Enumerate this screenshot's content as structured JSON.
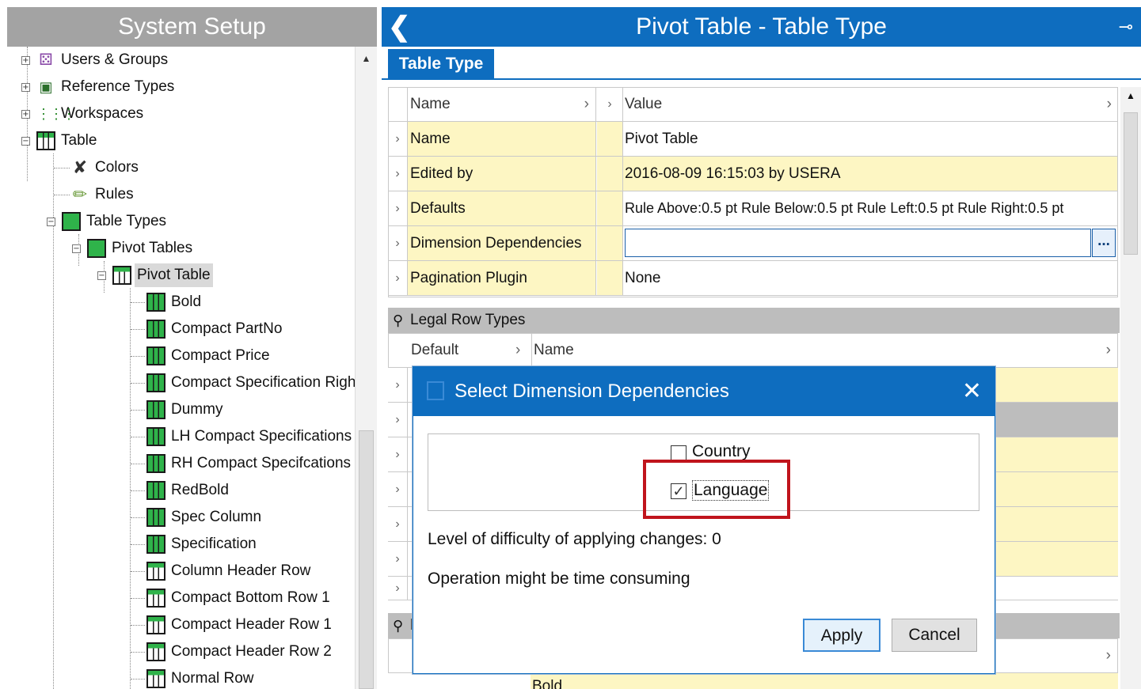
{
  "left_panel": {
    "title": "System Setup",
    "tree": [
      {
        "label": "Users & Groups",
        "icon": "users-icon"
      },
      {
        "label": "Reference Types",
        "icon": "reference-icon"
      },
      {
        "label": "Workspaces",
        "icon": "workspaces-icon"
      },
      {
        "label": "Table",
        "icon": "table-icon"
      },
      {
        "label": "Colors",
        "icon": "colors-icon"
      },
      {
        "label": "Rules",
        "icon": "rules-icon"
      },
      {
        "label": "Table Types",
        "icon": "table-types-icon"
      },
      {
        "label": "Pivot Tables",
        "icon": "pivot-tables-icon"
      },
      {
        "label": "Pivot Table",
        "icon": "pivot-table-icon",
        "selected": true
      },
      {
        "label": "Bold",
        "icon": "row-type-icon"
      },
      {
        "label": "Compact PartNo",
        "icon": "row-type-icon"
      },
      {
        "label": "Compact Price",
        "icon": "row-type-icon"
      },
      {
        "label": "Compact Specification Right",
        "icon": "row-type-icon"
      },
      {
        "label": "Dummy",
        "icon": "row-type-icon"
      },
      {
        "label": "LH Compact Specifications",
        "icon": "row-type-icon"
      },
      {
        "label": "RH Compact Specifcations",
        "icon": "row-type-icon"
      },
      {
        "label": "RedBold",
        "icon": "row-type-icon"
      },
      {
        "label": "Spec Column",
        "icon": "row-type-icon"
      },
      {
        "label": "Specification",
        "icon": "row-type-icon"
      },
      {
        "label": "Column Header Row",
        "icon": "header-row-icon"
      },
      {
        "label": "Compact Bottom Row 1",
        "icon": "header-row-icon"
      },
      {
        "label": "Compact Header Row 1",
        "icon": "header-row-icon"
      },
      {
        "label": "Compact Header Row 2",
        "icon": "header-row-icon"
      },
      {
        "label": "Normal Row",
        "icon": "header-row-icon"
      }
    ]
  },
  "right_panel": {
    "title": "Pivot Table - Table Type",
    "tab": "Table Type",
    "grid": {
      "header": {
        "name": "Name",
        "value": "Value"
      },
      "rows": [
        {
          "name": "Name",
          "value": "Pivot Table"
        },
        {
          "name": "Edited by",
          "value": "2016-08-09 16:15:03 by USERA"
        },
        {
          "name": "Defaults",
          "value": "Rule Above:0.5 pt Rule Below:0.5 pt Rule Left:0.5 pt Rule Right:0.5 pt"
        },
        {
          "name": "Dimension Dependencies",
          "value": ""
        },
        {
          "name": "Pagination Plugin",
          "value": "None"
        }
      ],
      "browse_label": "..."
    },
    "legal_row_types": {
      "title": "Legal Row Types",
      "header": {
        "default": "Default",
        "name": "Name"
      },
      "partial_row_name": "Bold"
    },
    "second_section_title": "l"
  },
  "dialog": {
    "title": "Select Dimension Dependencies",
    "options": [
      {
        "label": "Country",
        "checked": false
      },
      {
        "label": "Language",
        "checked": true
      }
    ],
    "difficulty_text": "Level of difficulty of applying changes: 0",
    "warning_text": "Operation might be time consuming",
    "apply_label": "Apply",
    "cancel_label": "Cancel"
  },
  "colors": {
    "accent": "#0e6dbf",
    "highlight": "#c0141c",
    "field_yellow": "#fdf6c3"
  }
}
